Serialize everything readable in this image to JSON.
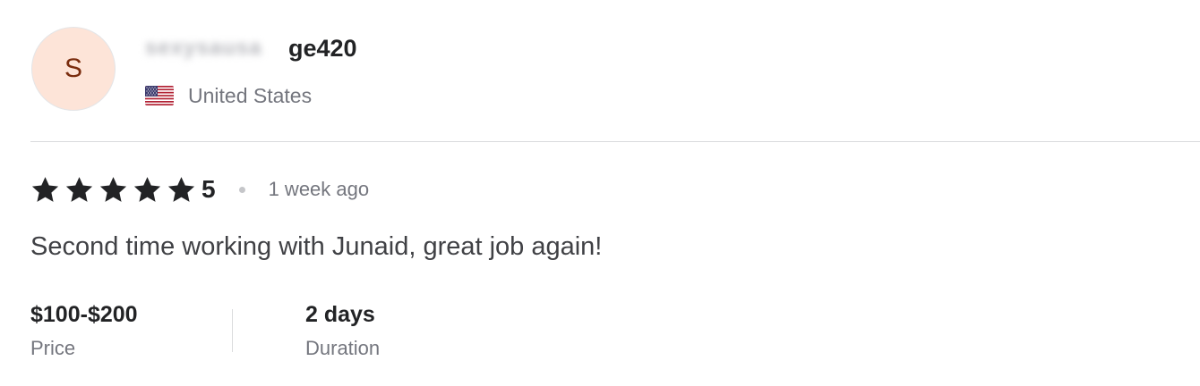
{
  "reviewer": {
    "avatar_letter": "S",
    "username_obscured": "sexysausa",
    "username_visible": "ge420",
    "country": "United States",
    "flag_icon": "us-flag-icon"
  },
  "rating": {
    "stars": 5,
    "value": "5",
    "time_ago": "1 week ago",
    "star_color": "#222325"
  },
  "comment": "Second time working with Junaid, great job again!",
  "stats": {
    "price": {
      "value": "$100-$200",
      "label": "Price"
    },
    "duration": {
      "value": "2 days",
      "label": "Duration"
    }
  },
  "colors": {
    "avatar_bg": "#fde4d8",
    "avatar_text": "#7a2c0e",
    "muted_text": "#74767e"
  }
}
